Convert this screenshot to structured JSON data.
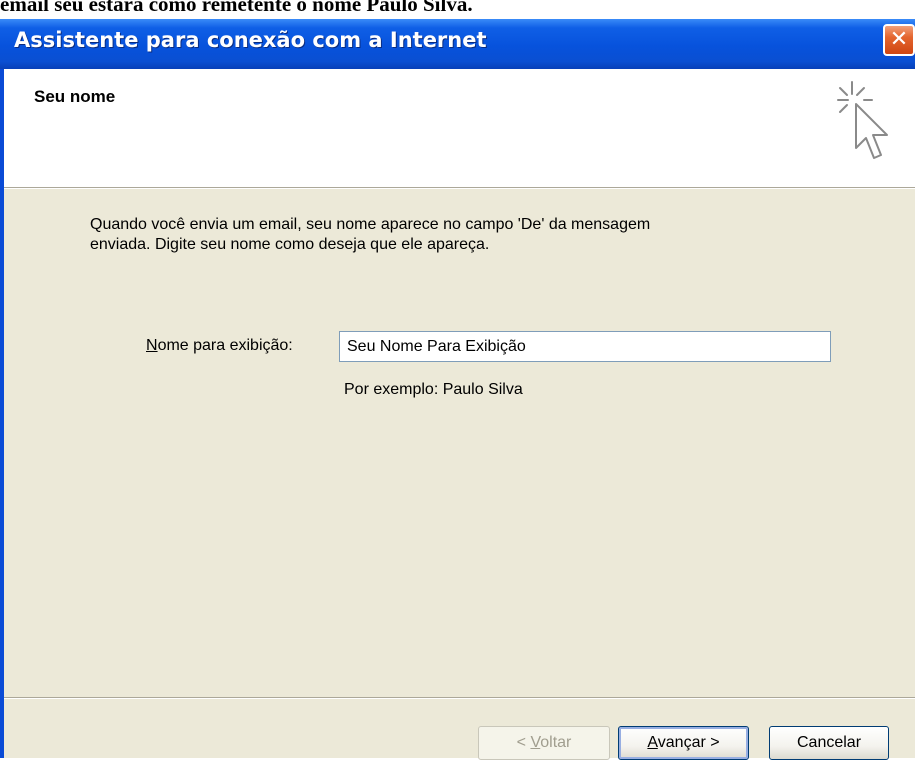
{
  "caption": "email seu estará como remetente o nome Paulo Silva.",
  "window": {
    "title": "Assistente para conexão com a Internet",
    "close_glyph": "✕"
  },
  "header": {
    "title": "Seu nome",
    "icon": "wizard-cursor-icon"
  },
  "body": {
    "intro_line1": "Quando você envia um email, seu nome aparece no campo 'De' da mensagem",
    "intro_line2": "enviada. Digite seu nome como deseja que ele apareça.",
    "name_label_access_key": "N",
    "name_label_rest": "ome para exibição:",
    "name_value": "Seu Nome Para Exibição",
    "example": "Por exemplo: Paulo Silva"
  },
  "buttons": {
    "back_prefix": "< ",
    "back_key": "V",
    "back_rest": "oltar",
    "next_key": "A",
    "next_rest": "vançar >",
    "cancel": "Cancelar"
  },
  "colors": {
    "titlebar": "#0752dc",
    "dialog_background": "#ece9d8",
    "header_background": "#ffffff",
    "close_button": "#e4652e"
  }
}
